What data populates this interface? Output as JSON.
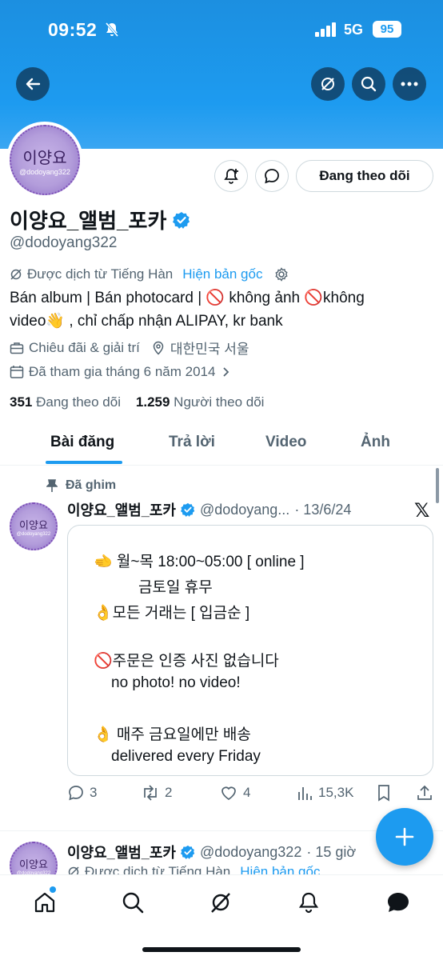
{
  "status_bar": {
    "time": "09:52",
    "network": "5G",
    "battery": "95"
  },
  "header_icons": {
    "back": "arrow-left-icon",
    "translate": "translate-icon",
    "search": "search-icon",
    "more": "more-icon"
  },
  "profile": {
    "avatar_text": "이양요",
    "avatar_sub": "@dodoyang322",
    "display_name": "이양요_앨범_포카",
    "handle": "@dodoyang322",
    "follow_label": "Đang theo dõi",
    "translated_note": "Được dịch từ Tiếng Hàn",
    "show_original": "Hiện bản gốc",
    "bio_line1": "Bán album | Bán photocard | 🚫 không ảnh 🚫không",
    "bio_line2": "video👋 , chỉ chấp nhận ALIPAY, kr bank",
    "category": "Chiêu đãi & giải trí",
    "location": "대한민국 서울",
    "joined": "Đã tham gia tháng 6 năm 2014",
    "following_count": "351",
    "following_label": "Đang theo dõi",
    "followers_count": "1.259",
    "followers_label": "Người theo dõi"
  },
  "tabs": [
    {
      "label": "Bài đăng",
      "active": true
    },
    {
      "label": "Trả lời",
      "active": false
    },
    {
      "label": "Video",
      "active": false
    },
    {
      "label": "Ảnh",
      "active": false
    }
  ],
  "pinned_post": {
    "pinned_label": "Đã ghim",
    "name": "이양요_앨범_포카",
    "handle": "@dodoyang...",
    "date": "· 13/6/24",
    "card_lines": [
      "🫲 월~목 18:00~05:00 [ online ]",
      "금토일 휴무",
      "👌모든 거래는 [ 입금순 ]",
      "🚫주문은 인증 사진 없습니다",
      "no photo!   no video!",
      "👌 매주 금요일에만 배송",
      "delivered every Friday"
    ],
    "replies": "3",
    "reposts": "2",
    "likes": "4",
    "views": "15,3K"
  },
  "second_post": {
    "name": "이양요_앨범_포카",
    "handle": "@dodoyang322",
    "time": "· 15 giờ",
    "translated_note": "Được dịch từ Tiếng Hàn",
    "show_original": "Hiện bản gốc"
  },
  "colors": {
    "accent": "#1d9bf0",
    "text": "#0f1419",
    "muted": "#536471"
  }
}
